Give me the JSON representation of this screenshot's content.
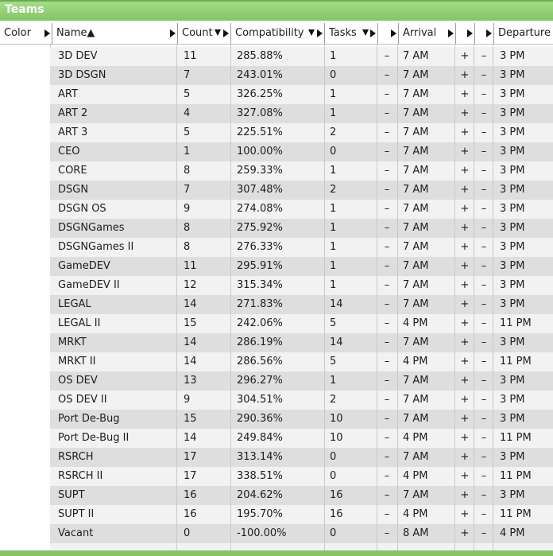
{
  "panel": {
    "title": "Teams"
  },
  "columns": {
    "color": "Color",
    "name": "Name",
    "name_sort": "▲",
    "count": "Count",
    "compatibility": "Compatibility",
    "tasks": "Tasks",
    "arrival": "Arrival",
    "departure": "Departure"
  },
  "buttons": {
    "minus": "–",
    "plus": "+"
  },
  "rows": [
    {
      "name": "3D DEV",
      "count": "11",
      "compatibility": "285.88%",
      "tasks": "1",
      "arrival": "7 AM",
      "departure": "3 PM"
    },
    {
      "name": "3D DSGN",
      "count": "7",
      "compatibility": "243.01%",
      "tasks": "0",
      "arrival": "7 AM",
      "departure": "3 PM"
    },
    {
      "name": "ART",
      "count": "5",
      "compatibility": "326.25%",
      "tasks": "1",
      "arrival": "7 AM",
      "departure": "3 PM"
    },
    {
      "name": "ART 2",
      "count": "4",
      "compatibility": "327.08%",
      "tasks": "1",
      "arrival": "7 AM",
      "departure": "3 PM"
    },
    {
      "name": "ART 3",
      "count": "5",
      "compatibility": "225.51%",
      "tasks": "2",
      "arrival": "7 AM",
      "departure": "3 PM"
    },
    {
      "name": "CEO",
      "count": "1",
      "compatibility": "100.00%",
      "tasks": "0",
      "arrival": "7 AM",
      "departure": "3 PM"
    },
    {
      "name": "CORE",
      "count": "8",
      "compatibility": "259.33%",
      "tasks": "1",
      "arrival": "7 AM",
      "departure": "3 PM"
    },
    {
      "name": "DSGN",
      "count": "7",
      "compatibility": "307.48%",
      "tasks": "2",
      "arrival": "7 AM",
      "departure": "3 PM"
    },
    {
      "name": "DSGN OS",
      "count": "9",
      "compatibility": "274.08%",
      "tasks": "1",
      "arrival": "7 AM",
      "departure": "3 PM"
    },
    {
      "name": "DSGNGames",
      "count": "8",
      "compatibility": "275.92%",
      "tasks": "1",
      "arrival": "7 AM",
      "departure": "3 PM"
    },
    {
      "name": "DSGNGames II",
      "count": "8",
      "compatibility": "276.33%",
      "tasks": "1",
      "arrival": "7 AM",
      "departure": "3 PM"
    },
    {
      "name": "GameDEV",
      "count": "11",
      "compatibility": "295.91%",
      "tasks": "1",
      "arrival": "7 AM",
      "departure": "3 PM"
    },
    {
      "name": "GameDEV II",
      "count": "12",
      "compatibility": "315.34%",
      "tasks": "1",
      "arrival": "7 AM",
      "departure": "3 PM"
    },
    {
      "name": "LEGAL",
      "count": "14",
      "compatibility": "271.83%",
      "tasks": "14",
      "arrival": "7 AM",
      "departure": "3 PM"
    },
    {
      "name": "LEGAL II",
      "count": "15",
      "compatibility": "242.06%",
      "tasks": "5",
      "arrival": "4 PM",
      "departure": "11 PM"
    },
    {
      "name": "MRKT",
      "count": "14",
      "compatibility": "286.19%",
      "tasks": "14",
      "arrival": "7 AM",
      "departure": "3 PM"
    },
    {
      "name": "MRKT II",
      "count": "14",
      "compatibility": "286.56%",
      "tasks": "5",
      "arrival": "4 PM",
      "departure": "11 PM"
    },
    {
      "name": "OS DEV",
      "count": "13",
      "compatibility": "296.27%",
      "tasks": "1",
      "arrival": "7 AM",
      "departure": "3 PM"
    },
    {
      "name": "OS DEV II",
      "count": "9",
      "compatibility": "304.51%",
      "tasks": "2",
      "arrival": "7 AM",
      "departure": "3 PM"
    },
    {
      "name": "Port De-Bug",
      "count": "15",
      "compatibility": "290.36%",
      "tasks": "10",
      "arrival": "7 AM",
      "departure": "3 PM"
    },
    {
      "name": "Port De-Bug II",
      "count": "14",
      "compatibility": "249.84%",
      "tasks": "10",
      "arrival": "4 PM",
      "departure": "11 PM"
    },
    {
      "name": "RSRCH",
      "count": "17",
      "compatibility": "313.14%",
      "tasks": "0",
      "arrival": "7 AM",
      "departure": "3 PM"
    },
    {
      "name": "RSRCH II",
      "count": "17",
      "compatibility": "338.51%",
      "tasks": "0",
      "arrival": "4 PM",
      "departure": "11 PM"
    },
    {
      "name": "SUPT",
      "count": "16",
      "compatibility": "204.62%",
      "tasks": "16",
      "arrival": "7 AM",
      "departure": "3 PM"
    },
    {
      "name": "SUPT II",
      "count": "16",
      "compatibility": "195.70%",
      "tasks": "16",
      "arrival": "4 PM",
      "departure": "11 PM"
    },
    {
      "name": "Vacant",
      "count": "0",
      "compatibility": "-100.00%",
      "tasks": "0",
      "arrival": "8 AM",
      "departure": "4 PM"
    }
  ]
}
